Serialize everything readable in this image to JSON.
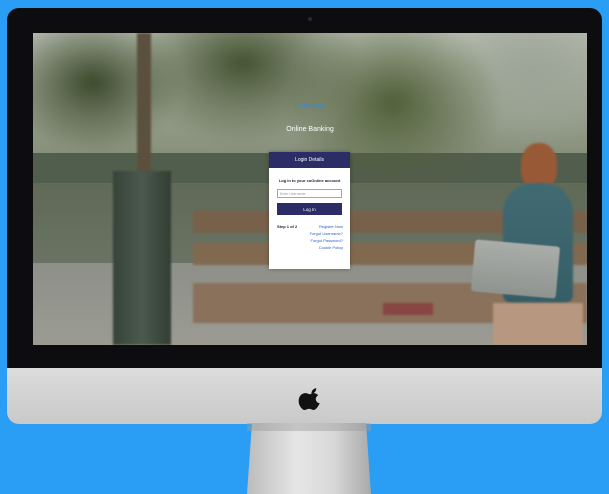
{
  "brand": {
    "logo_mark": "i",
    "name": "enterprise"
  },
  "page": {
    "headline": "Online Banking"
  },
  "login_card": {
    "header": "Login Details",
    "title": "Log in to your cuOnline account",
    "username_placeholder": "Enter Username",
    "login_button": "Log In",
    "step": "Step 1 of 2",
    "links": [
      "Register Now",
      "Forgot Username?",
      "Forgot Password?",
      "Cookie Policy"
    ]
  },
  "colors": {
    "background": "#2a9df4",
    "card_header": "#2c2d67",
    "button": "#2c2d67",
    "link": "#2c5ec7",
    "brand": "#2b8fe8"
  },
  "icons": {
    "hardware_logo": "apple-logo-icon"
  }
}
